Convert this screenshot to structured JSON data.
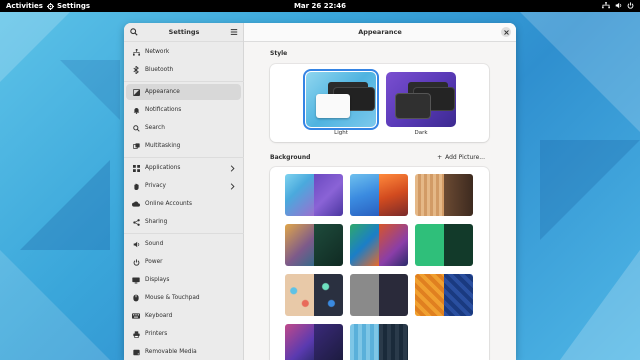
{
  "topbar": {
    "activities": "Activities",
    "app_name": "Settings",
    "clock": "Mar 26  22:46"
  },
  "sidebar": {
    "title": "Settings",
    "items": [
      {
        "label": "Network",
        "icon": "network-icon"
      },
      {
        "label": "Bluetooth",
        "icon": "bluetooth-icon"
      },
      {
        "label": "Appearance",
        "icon": "appearance-icon",
        "active": true
      },
      {
        "label": "Notifications",
        "icon": "bell-icon"
      },
      {
        "label": "Search",
        "icon": "search-icon"
      },
      {
        "label": "Multitasking",
        "icon": "multitasking-icon"
      },
      {
        "label": "Applications",
        "icon": "applications-icon",
        "chevron": true
      },
      {
        "label": "Privacy",
        "icon": "hand-icon",
        "chevron": true
      },
      {
        "label": "Online Accounts",
        "icon": "cloud-icon"
      },
      {
        "label": "Sharing",
        "icon": "share-icon"
      },
      {
        "label": "Sound",
        "icon": "speaker-icon"
      },
      {
        "label": "Power",
        "icon": "power-icon"
      },
      {
        "label": "Displays",
        "icon": "display-icon"
      },
      {
        "label": "Mouse & Touchpad",
        "icon": "mouse-icon"
      },
      {
        "label": "Keyboard",
        "icon": "keyboard-icon"
      },
      {
        "label": "Printers",
        "icon": "printer-icon"
      },
      {
        "label": "Removable Media",
        "icon": "media-icon"
      }
    ]
  },
  "main": {
    "title": "Appearance",
    "style_section": "Style",
    "style_options": [
      {
        "label": "Light",
        "selected": true
      },
      {
        "label": "Dark",
        "selected": false
      }
    ],
    "background_section": "Background",
    "add_picture": "Add Picture..."
  },
  "colors": {
    "accent": "#3584e4",
    "topbar": "#000000",
    "sidebar_bg": "#ebebeb"
  }
}
